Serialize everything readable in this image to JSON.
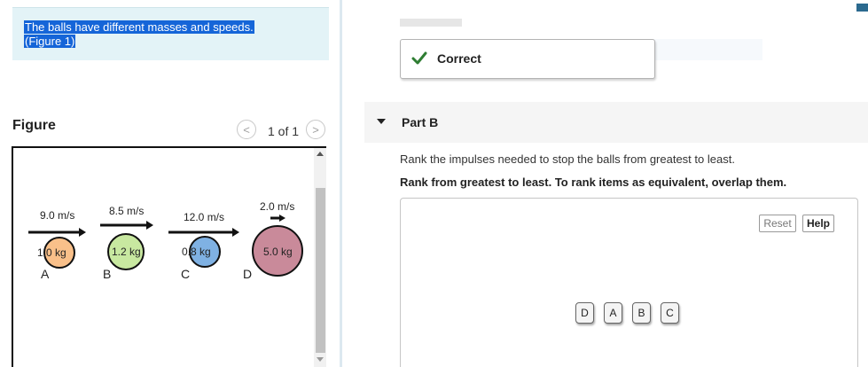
{
  "intro": {
    "line1": "The balls have different masses and speeds.",
    "line2": "(Figure 1)"
  },
  "figure": {
    "label": "Figure",
    "pager": {
      "prev_symbol": "<",
      "next_symbol": ">",
      "text": "1 of 1"
    },
    "balls": [
      {
        "letter": "A",
        "speed": "9.0 m/s",
        "mass": "1.0 kg",
        "color": "#f9c08a"
      },
      {
        "letter": "B",
        "speed": "8.5 m/s",
        "mass": "1.2 kg",
        "color": "#c8e8a0"
      },
      {
        "letter": "C",
        "speed": "12.0 m/s",
        "mass": "0.8 kg",
        "color": "#7fb1e3"
      },
      {
        "letter": "D",
        "speed": "2.0 m/s",
        "mass": "5.0 kg",
        "color": "#c98a9a"
      }
    ]
  },
  "feedback": {
    "status": "Correct",
    "color": "#2e7d32"
  },
  "part_b": {
    "title": "Part B",
    "question": "Rank the impulses needed to stop the balls from greatest to least.",
    "instruction": "Rank from greatest to least. To rank items as equivalent, overlap them.",
    "reset_label": "Reset",
    "help_label": "Help",
    "tiles": [
      "D",
      "A",
      "B",
      "C"
    ]
  },
  "colors": {
    "selection": "#1565d8",
    "intro_bg": "#e3f3f7",
    "part_header_bg": "#f5f5f5"
  }
}
